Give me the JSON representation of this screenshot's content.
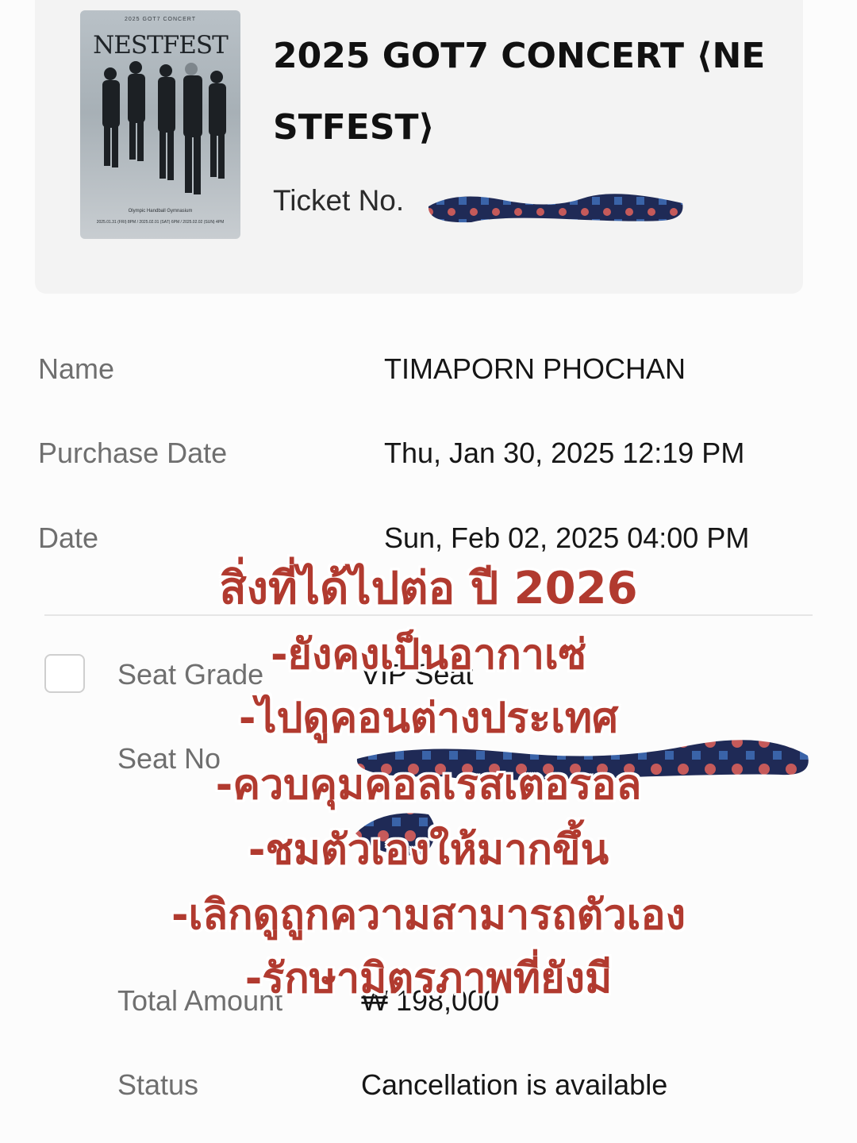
{
  "ticket": {
    "poster": {
      "top_text": "2025 GOT7 CONCERT",
      "logo": "NESTFEST",
      "venue": "Olympic Handball Gymnasium",
      "dates": "2025.01.31 (FRI) 8PM / 2025.02.01 (SAT) 6PM / 2025.02.02 (SUN) 4PM"
    },
    "title": "2025 GOT7 CONCERT ⟨NESTFEST⟩",
    "ticket_no_label": "Ticket No.",
    "ticket_no_value_icon": "redaction-scribble-icon"
  },
  "details": {
    "name_label": "Name",
    "name_value": "TIMAPORN PHOCHAN",
    "purchase_label": "Purchase Date",
    "purchase_value": "Thu, Jan 30, 2025 12:19 PM",
    "date_label": "Date",
    "date_value": "Sun, Feb 02, 2025 04:00 PM",
    "seat_grade_label": "Seat Grade",
    "seat_grade_value": "VIP Seat",
    "seat_no_label": "Seat No",
    "total_label": "Total Amount",
    "total_value": "₩ 198,000",
    "status_label": "Status",
    "status_value": "Cancellation is available"
  },
  "overlay": {
    "title": "สิ่งที่ได้ไปต่อ ปี 2026",
    "lines": [
      "-ยังคงเป็นอากาเซ่",
      "-ไปดูคอนต่างประเทศ",
      "-ควบคุมคอลเรสเตอรอล",
      "-ชมตัวเองให้มากขึ้น",
      "-เลิกดูถูกความสามารถตัวเอง",
      "-รักษามิตรภาพที่ยังมี"
    ],
    "color": "#b13a2f"
  }
}
